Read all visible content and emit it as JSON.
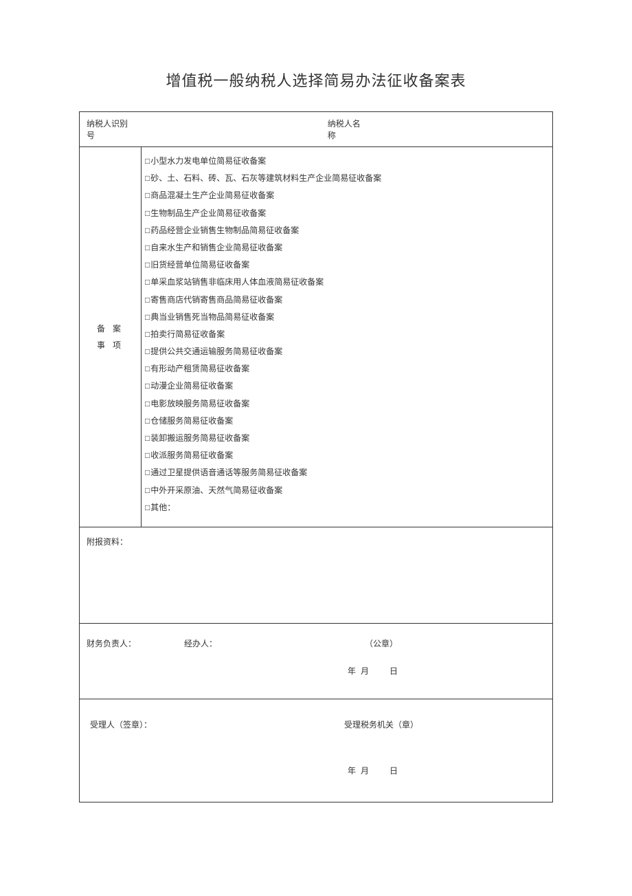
{
  "title": "增值税一般纳税人选择简易办法征收备案表",
  "header": {
    "taxpayer_id_label": "纳税人识别号",
    "taxpayer_name_label": "纳税人名称"
  },
  "category": {
    "label_line1": "备 案",
    "label_line2": "事 项"
  },
  "checklist": [
    "小型水力发电单位简易征收备案",
    "砂、土、石料、砖、瓦、石灰等建筑材料生产企业简易征收备案",
    "商品混凝土生产企业简易征收备案",
    "生物制品生产企业简易征收备案",
    "药品经营企业销售生物制品简易征收备案",
    "自来水生产和销售企业简易征收备案",
    "旧货经营单位简易征收备案",
    "单采血浆站销售非临床用人体血液简易征收备案",
    "寄售商店代销寄售商品简易征收备案",
    "典当业销售死当物品简易征收备案",
    "拍卖行简易征收备案",
    "提供公共交通运输服务简易征收备案",
    "有形动产租赁简易征收备案",
    "动漫企业简易征收备案",
    "电影放映服务简易征收备案",
    "仓储服务简易征收备案",
    "装卸搬运服务简易征收备案",
    "收派服务简易征收备案",
    "通过卫星提供语音通话等服务简易征收备案",
    "中外开采原油、天然气简易征收备案",
    "其他："
  ],
  "attachment_label": "附报资料：",
  "finance": {
    "person_label": "财务负责人：",
    "handler_label": "经办人：",
    "stamp_label": "（公章）",
    "date_label": "年 月　　日"
  },
  "acceptor": {
    "sign_label": "受理人（签章）：",
    "org_label": "受理税务机关（章）",
    "date_label": "年 月　　日"
  },
  "checkbox_symbol": "□"
}
